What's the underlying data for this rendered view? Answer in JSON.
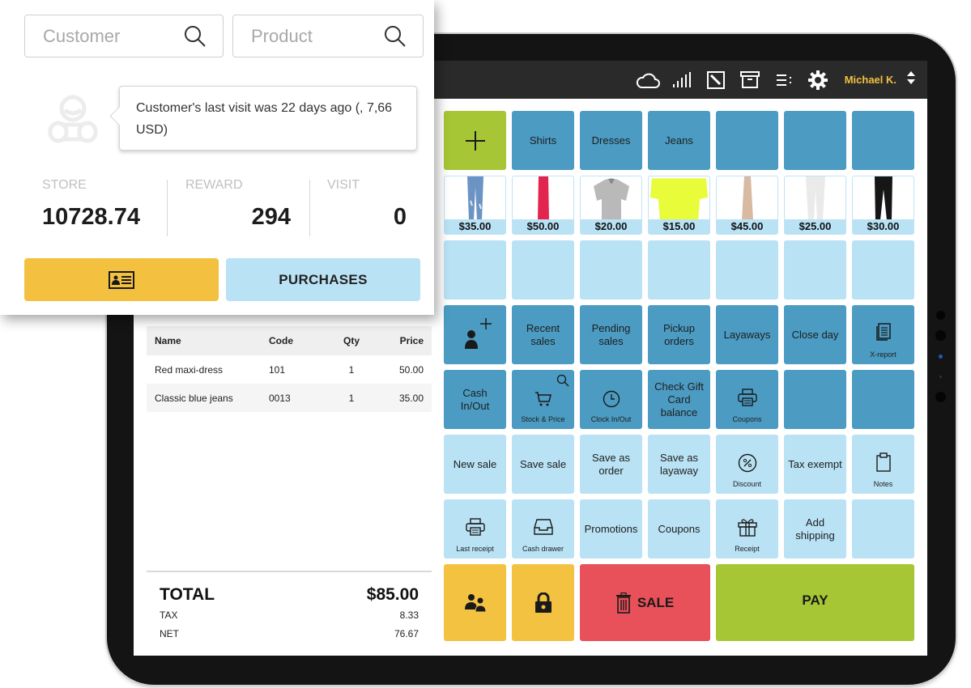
{
  "customer_popup": {
    "customer_search": {
      "placeholder": "Customer",
      "value": ""
    },
    "product_search": {
      "placeholder": "Product",
      "value": ""
    },
    "tooltip_text": "Customer's last visit was 22 days ago (, 7,66 USD)",
    "stats": [
      {
        "label": "STORE",
        "value": "10728.74"
      },
      {
        "label": "REWARD",
        "value": "294"
      },
      {
        "label": "VISIT",
        "value": "0"
      }
    ],
    "card_button_icon": "id-card-icon",
    "purchases_label": "PURCHASES"
  },
  "topbar": {
    "icons": [
      "cloud-icon",
      "signal-icon",
      "edit-icon",
      "archive-icon",
      "list-icon",
      "gear-icon"
    ],
    "user_name": "Michael K.",
    "user_name_color": "#f3c040"
  },
  "receipt": {
    "columns": [
      "Name",
      "Code",
      "Qty",
      "Price"
    ],
    "rows": [
      {
        "name": "Red maxi-dress",
        "code": "101",
        "qty": "1",
        "price": "50.00"
      },
      {
        "name": "Classic blue jeans",
        "code": "0013",
        "qty": "1",
        "price": "35.00"
      }
    ],
    "total_label": "TOTAL",
    "total_value": "$85.00",
    "tax_label": "TAX",
    "tax_value": "8.33",
    "net_label": "NET",
    "net_value": "76.67"
  },
  "grid": {
    "categories": [
      "Shirts",
      "Dresses",
      "Jeans"
    ],
    "products": [
      {
        "price": "$35.00",
        "item": "blue jeans"
      },
      {
        "price": "$50.00",
        "item": "red dress"
      },
      {
        "price": "$20.00",
        "item": "grey polo shirt"
      },
      {
        "price": "$15.00",
        "item": "yellow t-shirt"
      },
      {
        "price": "$45.00",
        "item": "beige dress"
      },
      {
        "price": "$25.00",
        "item": "white pants"
      },
      {
        "price": "$30.00",
        "item": "black pants"
      }
    ],
    "row4": {
      "recent_sales": "Recent sales",
      "pending_sales": "Pending sales",
      "pickup_orders": "Pickup orders",
      "layaways": "Layaways",
      "close_day": "Close day",
      "x_report": "X-report"
    },
    "row5": {
      "cash_in_out": "Cash In/Out",
      "stock_price": "Stock & Price",
      "clock_in_out": "Clock In/Out",
      "check_gift_card": "Check Gift Card balance",
      "coupons": "Coupons"
    },
    "row6": {
      "new_sale": "New sale",
      "save_sale": "Save sale",
      "save_as_order": "Save as order",
      "save_as_layaway": "Save as layaway",
      "discount": "Discount",
      "tax_exempt": "Tax exempt",
      "notes": "Notes"
    },
    "row7": {
      "last_receipt": "Last receipt",
      "cash_drawer": "Cash drawer",
      "promotions": "Promotions",
      "coupons": "Coupons",
      "receipt": "Receipt",
      "add_shipping": "Add shipping"
    },
    "row8": {
      "sale_label": "SALE",
      "pay_label": "PAY"
    }
  },
  "colors": {
    "tile_dark": "#4b9bc2",
    "tile_light": "#b9e2f4",
    "green": "#a6c636",
    "yellow": "#f2c240",
    "red": "#e8505a"
  }
}
